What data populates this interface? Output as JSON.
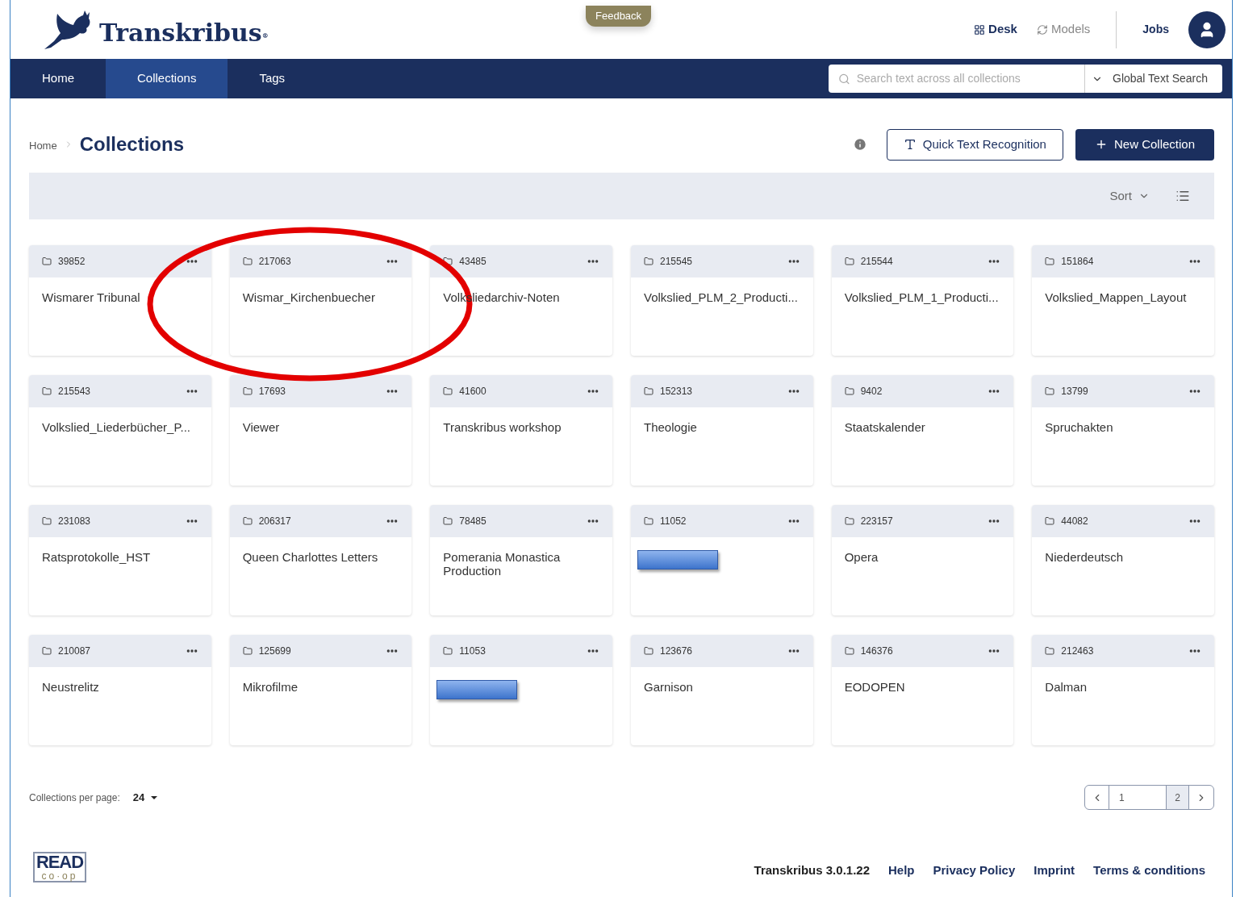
{
  "header": {
    "logo_text": "Transkribus",
    "logo_mark": "®",
    "feedback": "Feedback",
    "links": [
      {
        "label": "Desk",
        "kind": "desk",
        "active": true
      },
      {
        "label": "Models",
        "kind": "models",
        "active": false
      }
    ],
    "jobs": "Jobs"
  },
  "nav": {
    "tabs": [
      {
        "label": "Home",
        "selected": false
      },
      {
        "label": "Collections",
        "selected": true
      },
      {
        "label": "Tags",
        "selected": false
      }
    ],
    "search": {
      "placeholder": "Search text across all collections"
    },
    "search_scope": "Global Text Search"
  },
  "breadcrumb": {
    "parent": "Home",
    "current": "Collections"
  },
  "actions": {
    "quick": "Quick Text Recognition",
    "new": "New Collection"
  },
  "toolbar": {
    "sort": "Sort"
  },
  "collections": [
    {
      "id": "39852",
      "name": "Wismarer Tribunal",
      "kind": "named"
    },
    {
      "id": "217063",
      "name": "Wismar_Kirchenbuecher",
      "kind": "named"
    },
    {
      "id": "43485",
      "name": "Volksliedarchiv-Noten",
      "kind": "named"
    },
    {
      "id": "215545",
      "name": "Volkslied_PLM_2_Producti...",
      "kind": "named"
    },
    {
      "id": "215544",
      "name": "Volkslied_PLM_1_Producti...",
      "kind": "named"
    },
    {
      "id": "151864",
      "name": "Volkslied_Mappen_Layout",
      "kind": "named"
    },
    {
      "id": "215543",
      "name": "Volkslied_Liederbücher_P...",
      "kind": "named"
    },
    {
      "id": "17693",
      "name": "Viewer",
      "kind": "named"
    },
    {
      "id": "41600",
      "name": "Transkribus workshop",
      "kind": "named"
    },
    {
      "id": "152313",
      "name": "Theologie",
      "kind": "named"
    },
    {
      "id": "9402",
      "name": "Staatskalender",
      "kind": "named"
    },
    {
      "id": "13799",
      "name": "Spruchakten",
      "kind": "named"
    },
    {
      "id": "231083",
      "name": "Ratsprotokolle_HST",
      "kind": "named"
    },
    {
      "id": "206317",
      "name": "Queen Charlottes Letters",
      "kind": "named"
    },
    {
      "id": "78485",
      "name": "Pomerania Monastica Production",
      "kind": "named"
    },
    {
      "id": "11052",
      "kind": "redacted"
    },
    {
      "id": "223157",
      "name": "Opera",
      "kind": "named"
    },
    {
      "id": "44082",
      "name": "Niederdeutsch",
      "kind": "named"
    },
    {
      "id": "210087",
      "name": "Neustrelitz",
      "kind": "named"
    },
    {
      "id": "125699",
      "name": "Mikrofilme",
      "kind": "named"
    },
    {
      "id": "11053",
      "kind": "redacted"
    },
    {
      "id": "123676",
      "name": "Garnison",
      "kind": "named"
    },
    {
      "id": "146376",
      "name": "EODOPEN",
      "kind": "named"
    },
    {
      "id": "212463",
      "name": "Dalman",
      "kind": "named"
    }
  ],
  "pagination": {
    "per_page_label": "Collections per page:",
    "per_page": "24",
    "current": "1",
    "total": "2"
  },
  "footer": {
    "logo_top": "READ",
    "logo_bottom": "co·op",
    "version": "Transkribus 3.0.1.22",
    "links": [
      "Help",
      "Privacy Policy",
      "Imprint",
      "Terms & conditions"
    ]
  }
}
